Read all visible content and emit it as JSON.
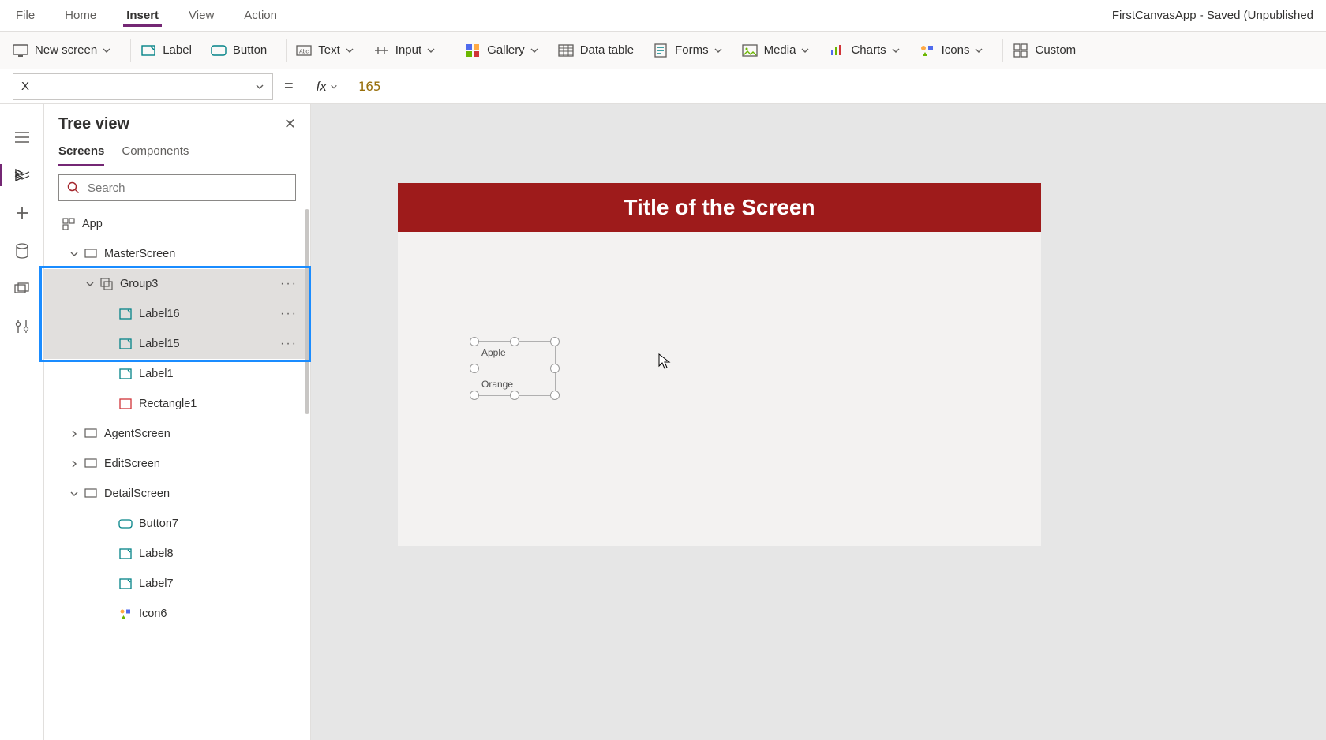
{
  "menubar": {
    "items": [
      "File",
      "Home",
      "Insert",
      "View",
      "Action"
    ],
    "active_index": 2,
    "app_title": "FirstCanvasApp - Saved (Unpublished"
  },
  "ribbon": {
    "new_screen": "New screen",
    "label": "Label",
    "button": "Button",
    "text": "Text",
    "input": "Input",
    "gallery": "Gallery",
    "data_table": "Data table",
    "forms": "Forms",
    "media": "Media",
    "charts": "Charts",
    "icons": "Icons",
    "custom": "Custom"
  },
  "formula": {
    "property": "X",
    "fx": "fx",
    "value": "165"
  },
  "panel": {
    "title": "Tree view",
    "tabs": [
      "Screens",
      "Components"
    ],
    "active_tab": 0,
    "search_placeholder": "Search"
  },
  "tree": {
    "app": "App",
    "rows": [
      {
        "label": "MasterScreen",
        "type": "screen",
        "chev": "down",
        "pad": 1
      },
      {
        "label": "Group3",
        "type": "group",
        "chev": "down",
        "pad": 2,
        "selected": true,
        "more": true
      },
      {
        "label": "Label16",
        "type": "label",
        "pad": 3,
        "selected": true,
        "more": true
      },
      {
        "label": "Label15",
        "type": "label",
        "pad": 3,
        "selected": true,
        "more": true
      },
      {
        "label": "Label1",
        "type": "label",
        "pad": 3
      },
      {
        "label": "Rectangle1",
        "type": "rect",
        "pad": 3
      },
      {
        "label": "AgentScreen",
        "type": "screen",
        "chev": "right",
        "pad": 1
      },
      {
        "label": "EditScreen",
        "type": "screen",
        "chev": "right",
        "pad": 1
      },
      {
        "label": "DetailScreen",
        "type": "screen",
        "chev": "down",
        "pad": 1
      },
      {
        "label": "Button7",
        "type": "button",
        "pad": 3
      },
      {
        "label": "Label8",
        "type": "label",
        "pad": 3
      },
      {
        "label": "Label7",
        "type": "label",
        "pad": 3
      },
      {
        "label": "Icon6",
        "type": "icon",
        "pad": 3
      }
    ]
  },
  "canvas": {
    "title": "Title of the Screen",
    "group_labels": [
      "Apple",
      "Orange"
    ]
  },
  "colors": {
    "accent": "#742774",
    "brand_red": "#9e1b1b",
    "highlight": "#1a8cff"
  }
}
